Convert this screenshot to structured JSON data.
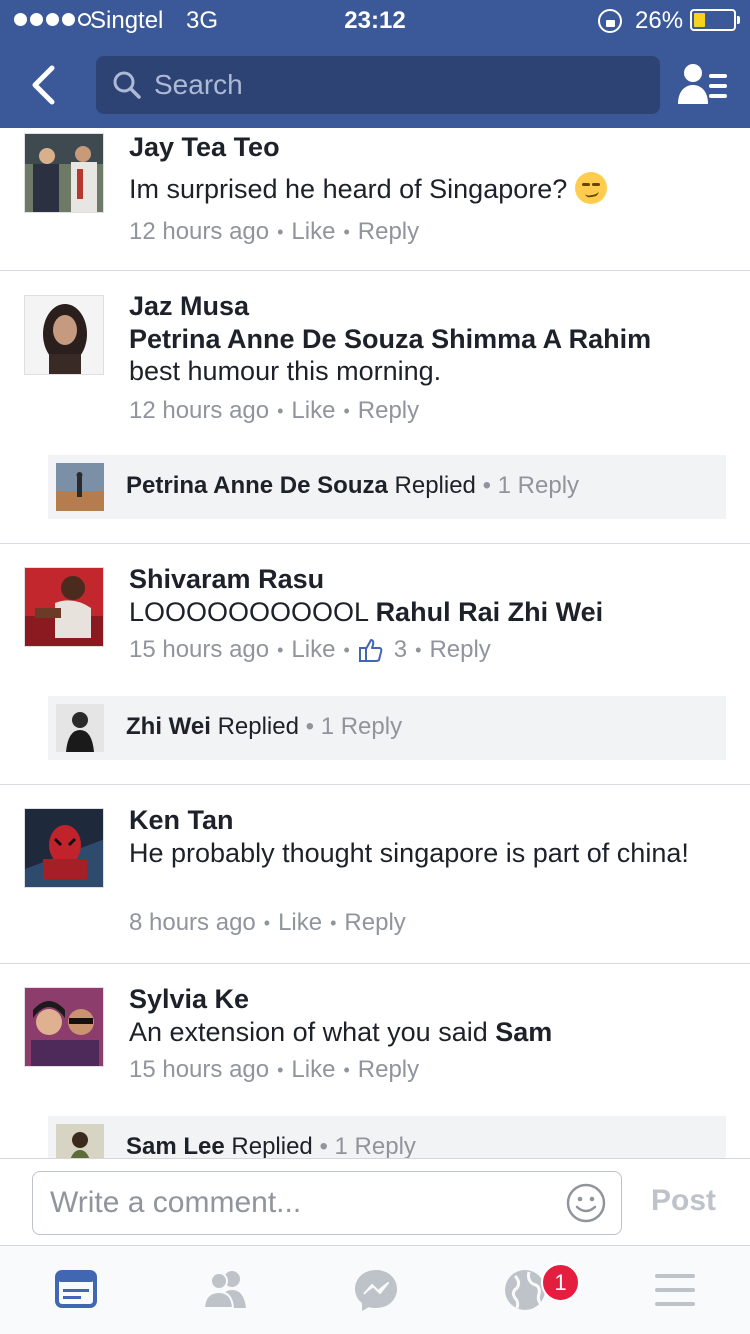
{
  "status_bar": {
    "carrier": "Singtel",
    "network": "3G",
    "time": "23:12",
    "battery": "26%",
    "battery_level": 0.26,
    "signal_bars": 4,
    "signal_total": 5
  },
  "nav": {
    "back_icon": "chevron-left-icon",
    "search_placeholder": "Search",
    "profile_icon": "friend-list-icon"
  },
  "comments": [
    {
      "name": "Jay Tea Teo",
      "text": "Im surprised he heard of Singapore?",
      "emoji": "smirk-emoji",
      "time": "12 hours ago",
      "like": "Like",
      "reply": "Reply"
    },
    {
      "name": "Jaz Musa",
      "tags": "Petrina Anne De Souza Shimma A Rahim",
      "text": "best humour this morning.",
      "time": "12 hours ago",
      "like": "Like",
      "reply": "Reply",
      "replied": {
        "name": "Petrina Anne De Souza",
        "label": "Replied",
        "count": "1 Reply"
      }
    },
    {
      "name": "Shivaram Rasu",
      "text": "LOOOOOOOOOOL",
      "tags": "Rahul Rai Zhi Wei",
      "time": "15 hours ago",
      "like": "Like",
      "likes_count": "3",
      "reply": "Reply",
      "replied": {
        "name": "Zhi Wei",
        "label": "Replied",
        "count": "1 Reply"
      }
    },
    {
      "name": "Ken Tan",
      "text": "He probably thought singapore is part of china!",
      "time": "8 hours ago",
      "like": "Like",
      "reply": "Reply"
    },
    {
      "name": "Sylvia Ke",
      "text": "An extension of what you said",
      "tags": "Sam",
      "time": "15 hours ago",
      "like": "Like",
      "reply": "Reply",
      "replied": {
        "name": "Sam Lee",
        "label": "Replied",
        "count": "1 Reply"
      }
    }
  ],
  "composer": {
    "placeholder": "Write a comment...",
    "post_label": "Post"
  },
  "tabbar": {
    "notification_badge": "1",
    "icons": [
      "news-feed-icon",
      "friends-icon",
      "messenger-icon",
      "notifications-globe-icon",
      "menu-icon"
    ],
    "active": "news-feed-icon"
  },
  "colors": {
    "brand": "#3b5998",
    "text": "#1d2129",
    "meta": "#90949c",
    "badge": "#e41e3f",
    "active_tab": "#4267b2"
  }
}
